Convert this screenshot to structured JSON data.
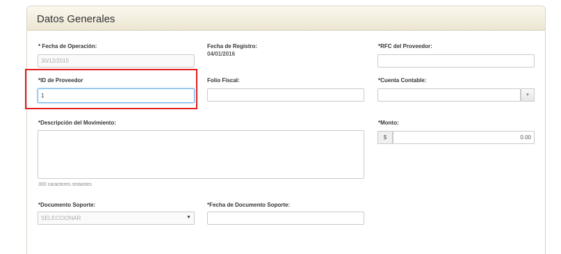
{
  "panel": {
    "title": "Datos Generales"
  },
  "fields": {
    "fecha_operacion": {
      "label": "* Fecha de Operación:",
      "value": "30/12/2015"
    },
    "fecha_registro": {
      "label": "Fecha de Registro:",
      "value": "04/01/2016"
    },
    "rfc_proveedor": {
      "label": "*RFC del Proveedor:",
      "value": ""
    },
    "id_proveedor": {
      "label": "*ID de Proveedor",
      "value": "1"
    },
    "folio_fiscal": {
      "label": "Folio Fiscal:",
      "value": ""
    },
    "cuenta_contable": {
      "label": "*Cuenta Contable:",
      "value": "",
      "button_icon": "chevron-down-icon",
      "button_glyph": "▾"
    },
    "descripcion": {
      "label": "*Descripción del Movimiento:",
      "value": "",
      "helper": "300 caracteres restantes"
    },
    "monto": {
      "label": "*Monto:",
      "currency": "$",
      "value": "0.00"
    },
    "documento_soporte": {
      "label": "*Documento Soporte:",
      "value": "SELECCIONAR",
      "caret": "▼"
    },
    "fecha_documento": {
      "label": "*Fecha de Documento Soporte:",
      "value": ""
    }
  },
  "highlight_color": "#e21b1b"
}
